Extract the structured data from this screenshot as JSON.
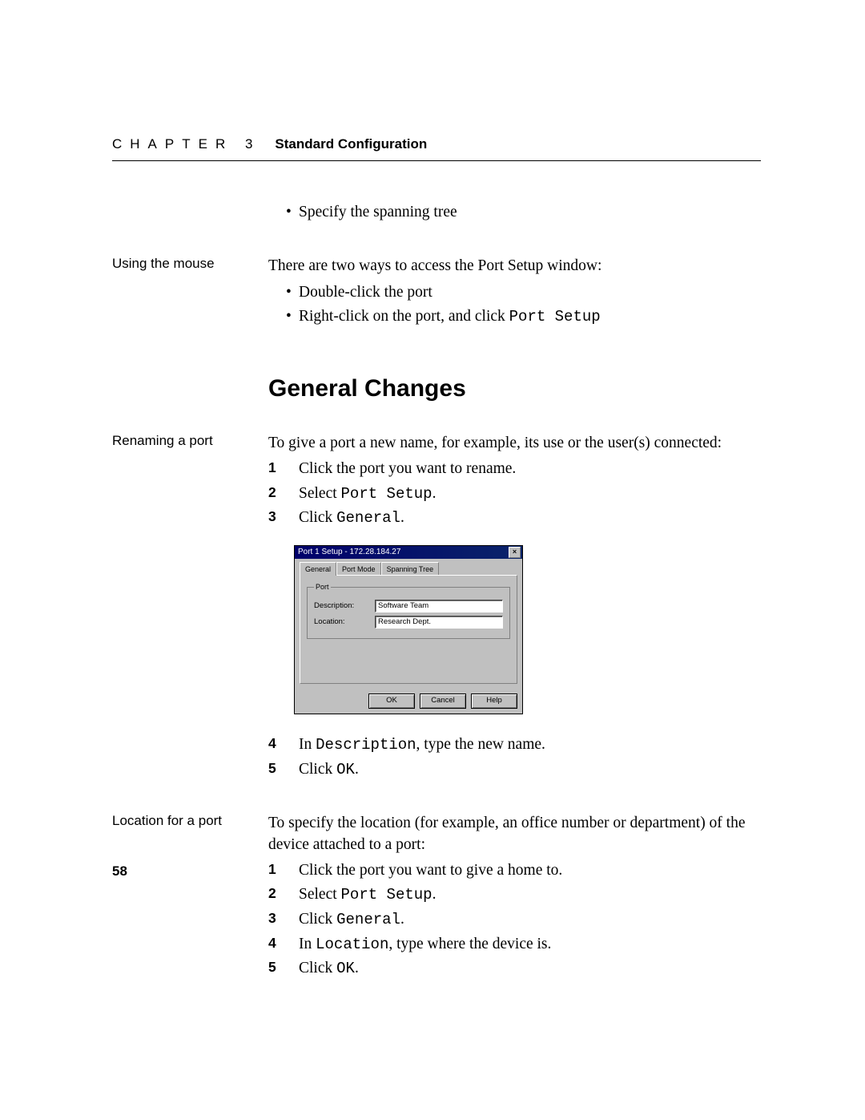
{
  "header": {
    "chapter_label": "CHAPTER 3",
    "title": "Standard Configuration"
  },
  "intro_bullet": "Specify the spanning tree",
  "margin_notes": {
    "mouse": "Using the mouse",
    "rename": "Renaming a port",
    "location": "Location for a port"
  },
  "mouse_intro": "There are two ways to access the Port Setup window:",
  "mouse_bullets": [
    "Double-click the port",
    "Right-click on the port, and click "
  ],
  "mouse_bullet2_code": "Port Setup",
  "section_heading": "General Changes",
  "rename_intro": "To give a port a new name, for example, its use or the user(s) connected:",
  "rename_steps": {
    "s1": "Click the port you want to rename.",
    "s2_pre": "Select ",
    "s2_code": "Port Setup",
    "s2_post": ".",
    "s3_pre": "Click ",
    "s3_code": "General",
    "s3_post": ".",
    "s4_pre": "In ",
    "s4_code": "Description",
    "s4_post": ", type the new name.",
    "s5_pre": "Click ",
    "s5_code": "OK",
    "s5_post": "."
  },
  "location_intro": "To specify the location (for example, an office number or department) of the device attached to a port:",
  "location_steps": {
    "s1": "Click the port you want to give a home to.",
    "s2_pre": "Select ",
    "s2_code": "Port Setup",
    "s2_post": ".",
    "s3_pre": "Click ",
    "s3_code": "General",
    "s3_post": ".",
    "s4_pre": "In ",
    "s4_code": "Location",
    "s4_post": ", type where the device is.",
    "s5_pre": "Click ",
    "s5_code": "OK",
    "s5_post": "."
  },
  "dialog": {
    "title": "Port 1 Setup - 172.28.184.27",
    "close": "×",
    "tabs": {
      "general": "General",
      "portmode": "Port Mode",
      "spanning": "Spanning Tree"
    },
    "group": "Port",
    "desc_label": "Description:",
    "desc_value": "Software Team",
    "loc_label": "Location:",
    "loc_value": "Research Dept.",
    "ok": "OK",
    "cancel": "Cancel",
    "help": "Help"
  },
  "page_number": "58"
}
